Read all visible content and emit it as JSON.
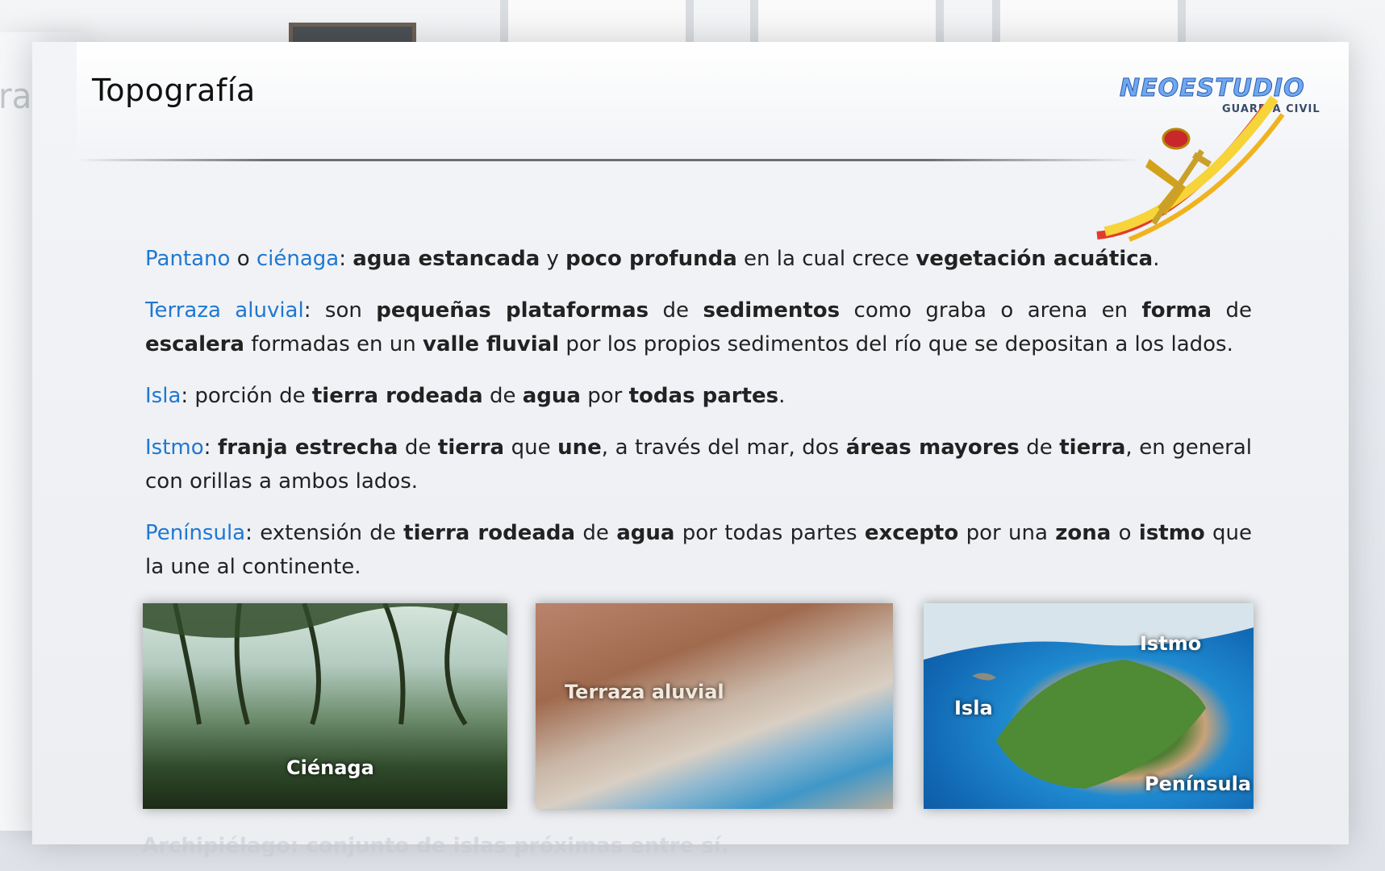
{
  "slide": {
    "title": "Topografía",
    "ghost_title": "rafía"
  },
  "logo": {
    "brand": "NEOESTUDIO",
    "subtitle": "GUARDIA CIVIL"
  },
  "paragraphs": [
    {
      "segments": [
        {
          "t": "Pantano",
          "s": "term"
        },
        {
          "t": " o ",
          "s": ""
        },
        {
          "t": "ciénaga",
          "s": "term"
        },
        {
          "t": ": ",
          "s": ""
        },
        {
          "t": "agua estancada",
          "s": "b"
        },
        {
          "t": " y ",
          "s": ""
        },
        {
          "t": "poco profunda",
          "s": "b"
        },
        {
          "t": " en la cual crece ",
          "s": ""
        },
        {
          "t": "vegetación acuática",
          "s": "b"
        },
        {
          "t": ".",
          "s": ""
        }
      ]
    },
    {
      "segments": [
        {
          "t": "Terraza aluvial",
          "s": "term"
        },
        {
          "t": ": son ",
          "s": ""
        },
        {
          "t": "pequeñas plataformas",
          "s": "b"
        },
        {
          "t": " de ",
          "s": ""
        },
        {
          "t": "sedimentos",
          "s": "b"
        },
        {
          "t": " como graba o arena en ",
          "s": ""
        },
        {
          "t": "forma",
          "s": "b"
        },
        {
          "t": " de ",
          "s": ""
        },
        {
          "t": "escalera",
          "s": "b"
        },
        {
          "t": " formadas en un ",
          "s": ""
        },
        {
          "t": "valle fluvial",
          "s": "b"
        },
        {
          "t": " por los propios sedimentos del río que se depositan a los lados.",
          "s": ""
        }
      ]
    },
    {
      "segments": [
        {
          "t": "Isla",
          "s": "term"
        },
        {
          "t": ": porción de ",
          "s": ""
        },
        {
          "t": "tierra rodeada",
          "s": "b"
        },
        {
          "t": " de ",
          "s": ""
        },
        {
          "t": "agua",
          "s": "b"
        },
        {
          "t": " por ",
          "s": ""
        },
        {
          "t": "todas partes",
          "s": "b"
        },
        {
          "t": ".",
          "s": ""
        }
      ]
    },
    {
      "segments": [
        {
          "t": "Istmo",
          "s": "term"
        },
        {
          "t": ": ",
          "s": ""
        },
        {
          "t": "franja estrecha",
          "s": "b"
        },
        {
          "t": " de ",
          "s": ""
        },
        {
          "t": "tierra",
          "s": "b"
        },
        {
          "t": " que ",
          "s": ""
        },
        {
          "t": "une",
          "s": "b"
        },
        {
          "t": ", a través del mar, dos ",
          "s": ""
        },
        {
          "t": "áreas mayores",
          "s": "b"
        },
        {
          "t": " de ",
          "s": ""
        },
        {
          "t": "tierra",
          "s": "b"
        },
        {
          "t": ", en general con orillas a ambos lados.",
          "s": ""
        }
      ]
    },
    {
      "segments": [
        {
          "t": "Península",
          "s": "term"
        },
        {
          "t": ": extensión de ",
          "s": ""
        },
        {
          "t": "tierra rodeada",
          "s": "b"
        },
        {
          "t": " de ",
          "s": ""
        },
        {
          "t": "agua",
          "s": "b"
        },
        {
          "t": " por todas partes ",
          "s": ""
        },
        {
          "t": "excepto",
          "s": "b"
        },
        {
          "t": " por una ",
          "s": ""
        },
        {
          "t": "zona",
          "s": "b"
        },
        {
          "t": " o ",
          "s": ""
        },
        {
          "t": "istmo",
          "s": "b"
        },
        {
          "t": " que la une al continente.",
          "s": ""
        }
      ]
    }
  ],
  "photos": {
    "cienaga": {
      "caption": "Ciénaga"
    },
    "terraza": {
      "caption": "Terraza aluvial"
    },
    "isla": {
      "label_istmo": "Istmo",
      "label_isla": "Isla",
      "label_peninsula": "Península"
    }
  },
  "footer_ghost": "Archipiélago: conjunto de islas próximas entre sí."
}
